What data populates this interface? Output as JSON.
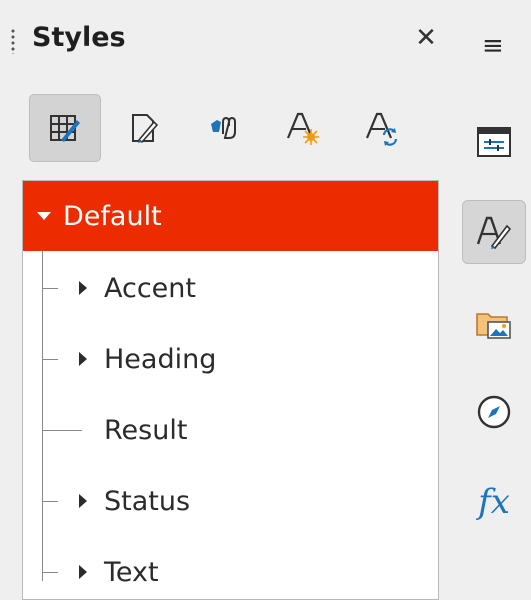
{
  "panel": {
    "title": "Styles",
    "close_glyph": "✕",
    "toolbar": [
      {
        "icon": "paragraph-styles-icon",
        "active": true
      },
      {
        "icon": "character-styles-icon",
        "active": false
      },
      {
        "icon": "fill-format-mode-icon",
        "active": false
      },
      {
        "icon": "new-style-icon",
        "active": false
      },
      {
        "icon": "update-style-icon",
        "active": false
      }
    ]
  },
  "tree": {
    "root": {
      "label": "Default",
      "expanded": true,
      "selected": true
    },
    "children": [
      {
        "label": "Accent",
        "expandable": true
      },
      {
        "label": "Heading",
        "expandable": true
      },
      {
        "label": "Result",
        "expandable": false
      },
      {
        "label": "Status",
        "expandable": true
      },
      {
        "label": "Text",
        "expandable": true
      }
    ]
  },
  "sidebar": {
    "menu_glyph": "≡",
    "buttons": [
      {
        "icon": "properties-icon",
        "active": false
      },
      {
        "icon": "styles-icon",
        "active": true
      },
      {
        "icon": "gallery-icon",
        "active": false
      },
      {
        "icon": "navigator-icon",
        "active": false
      },
      {
        "icon": "functions-icon",
        "label": "fx",
        "active": false
      }
    ]
  },
  "colors": {
    "selection": "#ed2b00",
    "accent_blue": "#1c75bc"
  }
}
